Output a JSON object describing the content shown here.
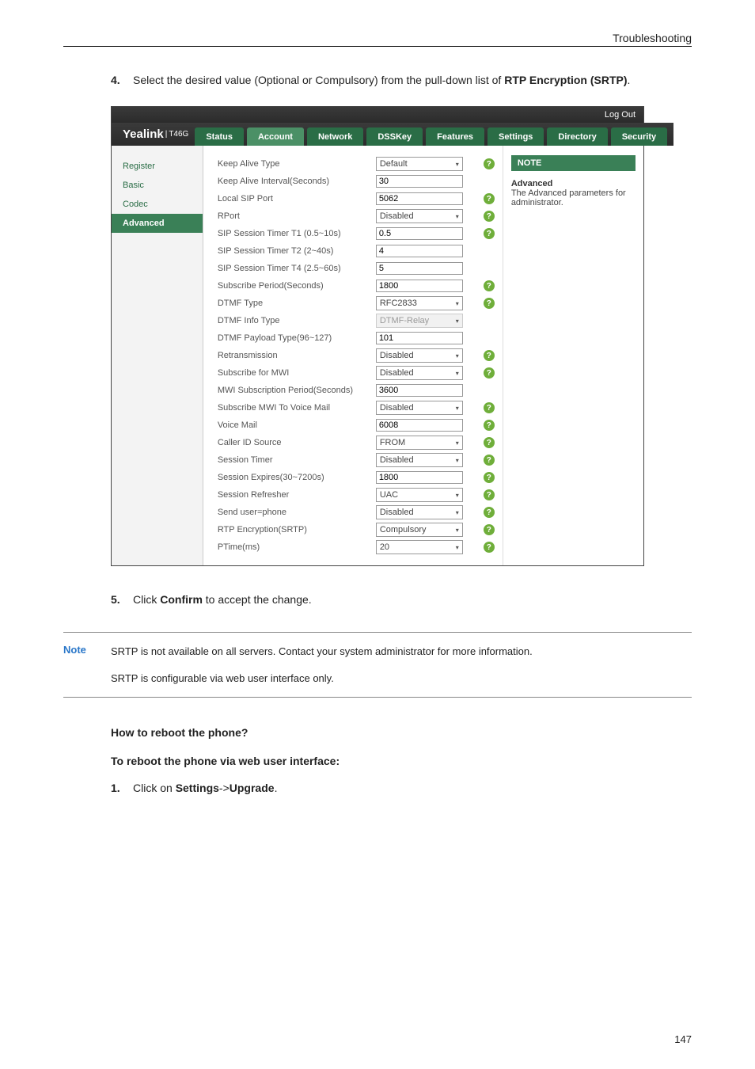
{
  "header": {
    "title": "Troubleshooting"
  },
  "step4": {
    "num": "4.",
    "prefix": "Select the desired value (Optional or Compulsory) from the pull-down list of ",
    "bold1": "RTP Encryption (SRTP)",
    "suffix": "."
  },
  "shot": {
    "logout": "Log Out",
    "brand": "Yealink",
    "model": "T46G",
    "tabs": [
      "Status",
      "Account",
      "Network",
      "DSSKey",
      "Features",
      "Settings",
      "Directory",
      "Security"
    ],
    "activeTab": "Account",
    "side": [
      "Register",
      "Basic",
      "Codec",
      "Advanced"
    ],
    "activeSide": "Advanced",
    "note": {
      "title": "NOTE",
      "bodyBold": "Advanced",
      "bodyRest": "The Advanced parameters for administrator."
    },
    "rows": [
      {
        "label": "Keep Alive Type",
        "type": "sel",
        "value": "Default",
        "q": true
      },
      {
        "label": "Keep Alive Interval(Seconds)",
        "type": "txt",
        "value": "30",
        "q": false
      },
      {
        "label": "Local SIP Port",
        "type": "txt",
        "value": "5062",
        "q": true
      },
      {
        "label": "RPort",
        "type": "sel",
        "value": "Disabled",
        "q": true
      },
      {
        "label": "SIP Session Timer T1 (0.5~10s)",
        "type": "txt",
        "value": "0.5",
        "q": true
      },
      {
        "label": "SIP Session Timer T2 (2~40s)",
        "type": "txt",
        "value": "4",
        "q": false
      },
      {
        "label": "SIP Session Timer T4 (2.5~60s)",
        "type": "txt",
        "value": "5",
        "q": false
      },
      {
        "label": "Subscribe Period(Seconds)",
        "type": "txt",
        "value": "1800",
        "q": true
      },
      {
        "label": "DTMF Type",
        "type": "sel",
        "value": "RFC2833",
        "q": true
      },
      {
        "label": "DTMF Info Type",
        "type": "selro",
        "value": "DTMF-Relay",
        "q": false
      },
      {
        "label": "DTMF Payload Type(96~127)",
        "type": "txt",
        "value": "101",
        "q": false
      },
      {
        "label": "Retransmission",
        "type": "sel",
        "value": "Disabled",
        "q": true
      },
      {
        "label": "Subscribe for MWI",
        "type": "sel",
        "value": "Disabled",
        "q": true
      },
      {
        "label": "MWI Subscription Period(Seconds)",
        "type": "txt",
        "value": "3600",
        "q": false
      },
      {
        "label": "Subscribe MWI To Voice Mail",
        "type": "sel",
        "value": "Disabled",
        "q": true
      },
      {
        "label": "Voice Mail",
        "type": "txt",
        "value": "6008",
        "q": true
      },
      {
        "label": "Caller ID Source",
        "type": "sel",
        "value": "FROM",
        "q": true
      },
      {
        "label": "Session Timer",
        "type": "sel",
        "value": "Disabled",
        "q": true
      },
      {
        "label": "Session Expires(30~7200s)",
        "type": "txt",
        "value": "1800",
        "q": true
      },
      {
        "label": "Session Refresher",
        "type": "sel",
        "value": "UAC",
        "q": true
      },
      {
        "label": "Send user=phone",
        "type": "sel",
        "value": "Disabled",
        "q": true
      },
      {
        "label": "RTP Encryption(SRTP)",
        "type": "sel",
        "value": "Compulsory",
        "q": true
      },
      {
        "label": "PTime(ms)",
        "type": "sel",
        "value": "20",
        "q": true
      }
    ]
  },
  "step5": {
    "num": "5.",
    "prefix": "Click ",
    "bold": "Confirm",
    "suffix": " to accept the change."
  },
  "callout": {
    "label": "Note",
    "p1": "SRTP is not available on all servers. Contact your system administrator for more information.",
    "p2": "SRTP is configurable via web user interface only."
  },
  "q": "How to reboot the phone?",
  "subhead": "To reboot the phone via web user interface:",
  "step1": {
    "num": "1.",
    "prefix": "Click on ",
    "bold1": "Settings",
    "mid": "->",
    "bold2": "Upgrade",
    "suffix": "."
  },
  "pagenum": "147"
}
